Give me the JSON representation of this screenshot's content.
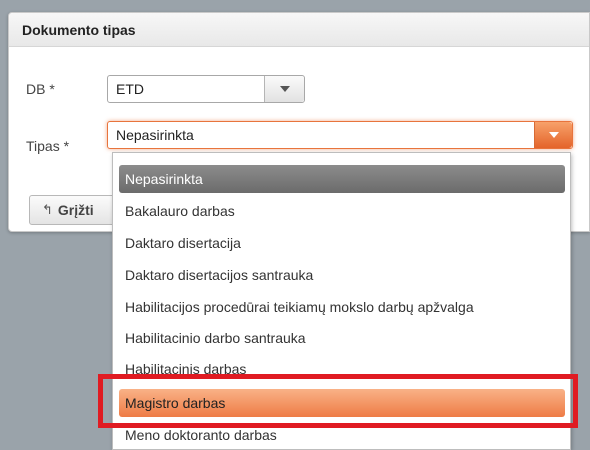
{
  "panel": {
    "title": "Dokumento tipas",
    "db_label": "DB *",
    "db_value": "ETD",
    "tipas_label": "Tipas *",
    "tipas_value": "Nepasirinkta",
    "back_button": "Grįžti"
  },
  "dropdown": {
    "options": [
      "Nepasirinkta",
      "Bakalauro darbas",
      "Daktaro disertacija",
      "Daktaro disertacijos santrauka",
      "Habilitacijos procedūrai teikiamų mokslo darbų apžvalga",
      "Habilitacinio darbo santrauka",
      "Habilitacinis darbas",
      "Magistro darbas",
      "Meno doktoranto darbas"
    ],
    "selected_index": 0,
    "hovered_index": 7
  },
  "colors": {
    "accent": "#e8743c",
    "highlight": "#e01b22",
    "selected_option": "#7a7a7a"
  },
  "icons": {
    "back": "back-arrow-icon",
    "caret": "chevron-down-icon"
  }
}
